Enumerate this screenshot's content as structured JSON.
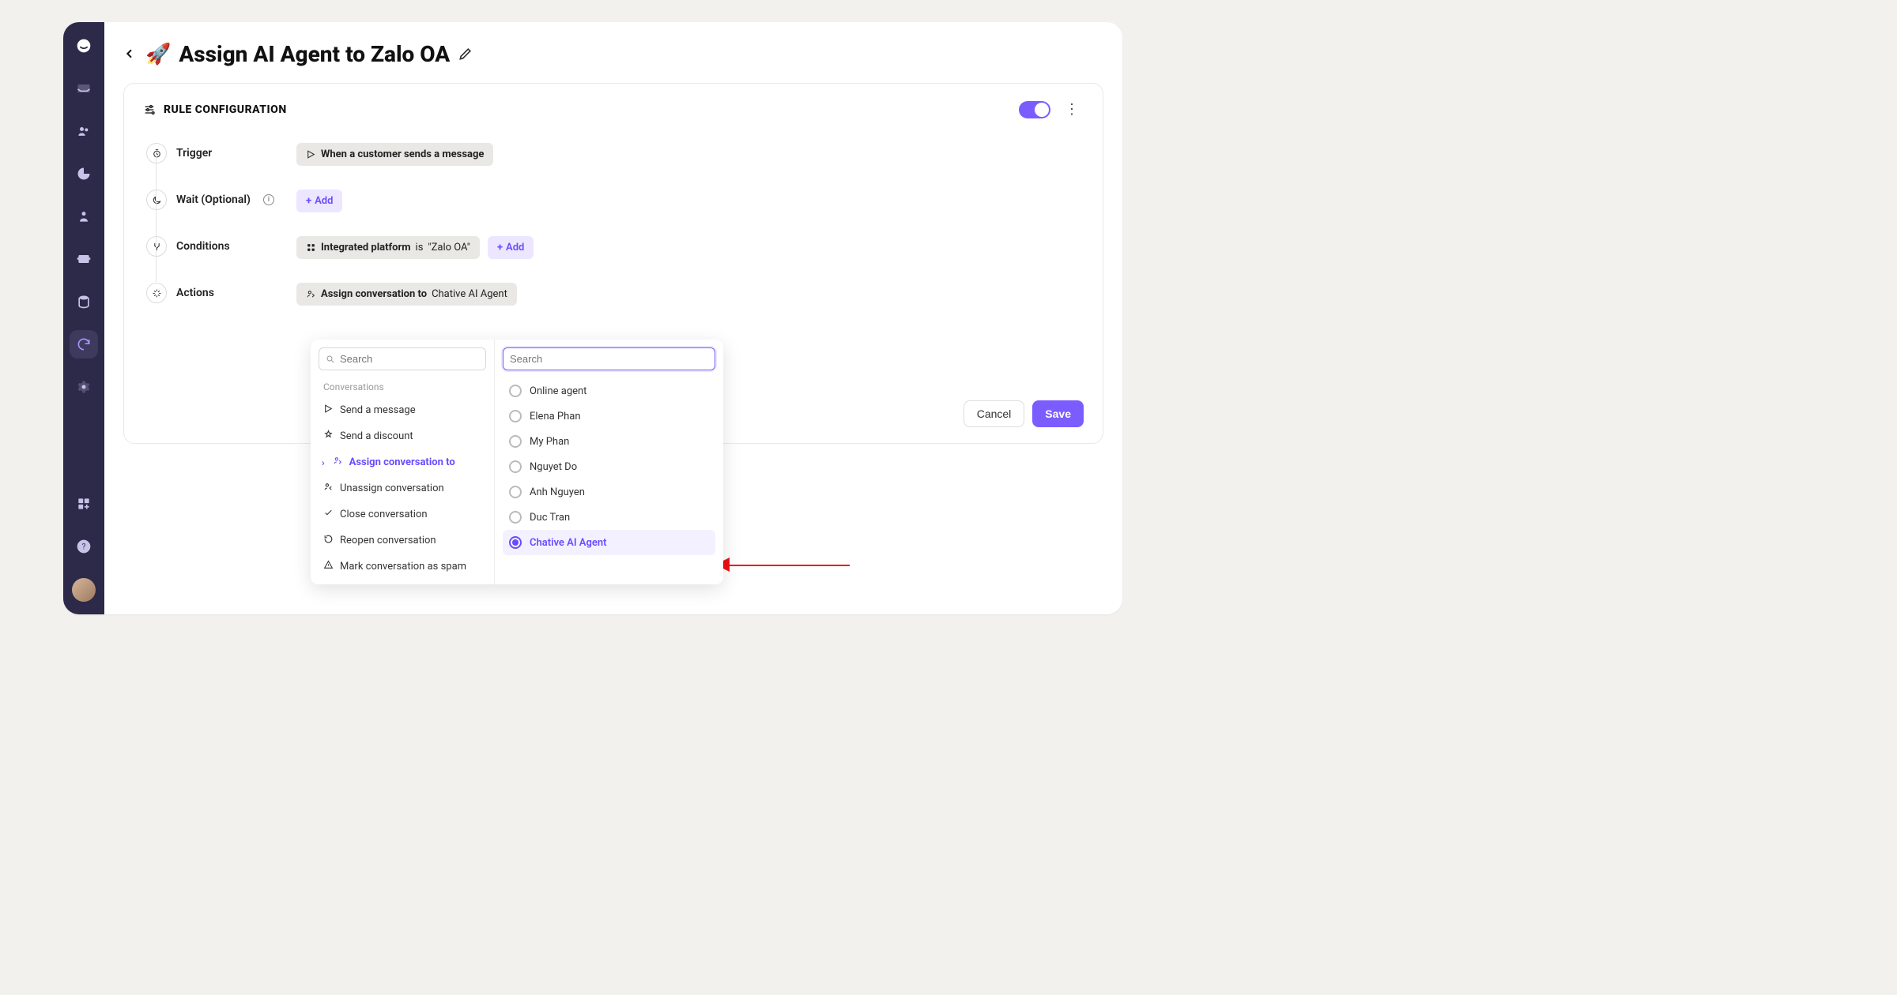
{
  "header": {
    "emoji": "🚀",
    "title": "Assign AI Agent to Zalo OA"
  },
  "card": {
    "heading": "RULE CONFIGURATION"
  },
  "steps": {
    "trigger": {
      "label": "Trigger",
      "chip": "When a customer sends a message"
    },
    "wait": {
      "label": "Wait (Optional)",
      "add": "Add"
    },
    "conditions": {
      "label": "Conditions",
      "chip_field": "Integrated platform",
      "chip_operator": " is ",
      "chip_value": "\"Zalo OA\"",
      "add": "Add"
    },
    "actions": {
      "label": "Actions",
      "chip_field": "Assign conversation to",
      "chip_value": "Chative AI Agent"
    }
  },
  "action_menu": {
    "search_placeholder": "Search",
    "group": "Conversations",
    "items": [
      "Send a message",
      "Send a discount",
      "Assign conversation to",
      "Unassign conversation",
      "Close conversation",
      "Reopen conversation",
      "Mark conversation as spam"
    ],
    "selected_index": 2
  },
  "agent_menu": {
    "search_placeholder": "Search",
    "items": [
      "Online agent",
      "Elena Phan",
      "My Phan",
      "Nguyet Do",
      "Anh Nguyen",
      "Duc Tran",
      "Chative AI Agent"
    ],
    "selected_index": 6
  },
  "footer": {
    "cancel": "Cancel",
    "save": "Save"
  }
}
